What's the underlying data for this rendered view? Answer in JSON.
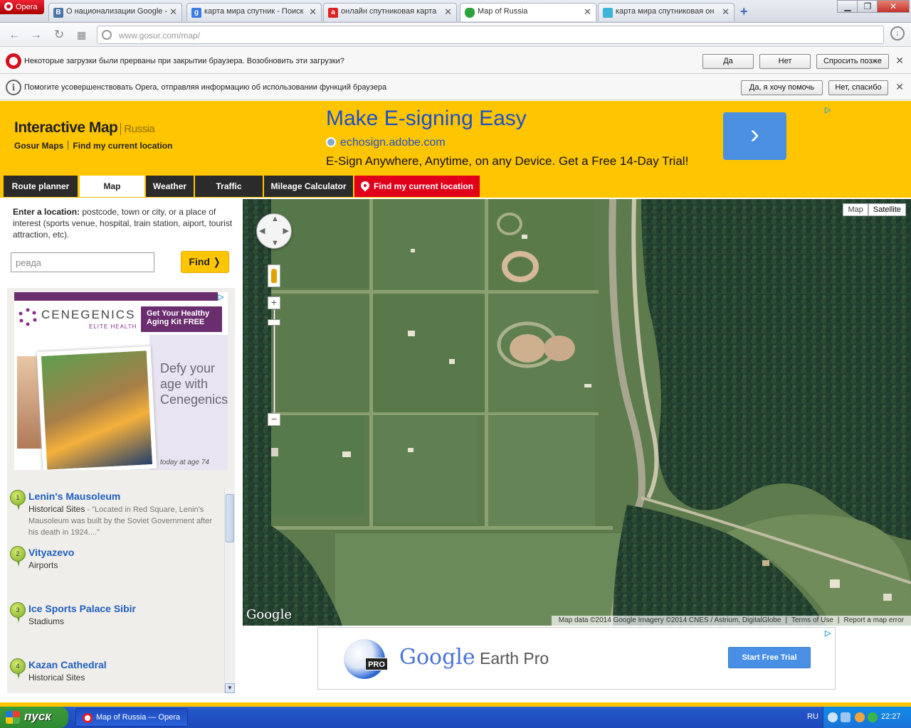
{
  "browser": {
    "menu_label": "Opera",
    "tabs": [
      {
        "label": "О национализации Google -",
        "icon": "vk-icon",
        "fav_letter": "B",
        "fav_color": "#4a76a8"
      },
      {
        "label": "карта мира спутник - Поиск",
        "icon": "google-icon",
        "fav_letter": "g",
        "fav_color": "#3b7be3"
      },
      {
        "label": "онлайн спутниковая карта",
        "icon": "ask-icon",
        "fav_letter": "a",
        "fav_color": "#d22"
      },
      {
        "label": "Map of Russia",
        "icon": "shield-icon",
        "fav_letter": "",
        "fav_color": "#2aa33a"
      },
      {
        "label": "карта мира спутниковая он",
        "icon": "earth-icon",
        "fav_letter": "",
        "fav_color": "#3cb4d8"
      }
    ],
    "url_host": "www.gosur.com",
    "url_path": "/map/",
    "infobar1": {
      "text": "Некоторые загрузки были прерваны при закрытии браузера. Возобновить эти загрузки?",
      "yes": "Да",
      "no": "Нет",
      "later": "Спросить позже"
    },
    "infobar2": {
      "text": "Помогите усовершенствовать Opera, отправляя информацию об использовании функций браузера",
      "yes": "Да, я хочу помочь",
      "no": "Нет, спасибо"
    }
  },
  "site": {
    "title": "Interactive Map",
    "subtitle": "Russia",
    "link1": "Gosur Maps",
    "link2": "Find my current location",
    "nav": [
      "Route planner",
      "Map",
      "Weather",
      "Traffic",
      "Mileage Calculator",
      "Find my current location"
    ],
    "top_ad": {
      "headline": "Make E-signing Easy",
      "url": "echosign.adobe.com",
      "desc": "E-Sign Anywhere, Anytime, on any Device. Get a Free 14-Day Trial!",
      "arrow": "›"
    },
    "location_label_bold": "Enter a location:",
    "location_label_rest": " postcode, town or city, or a place of interest (sports venue, hospital, train station, aiport, tourist attraction, etc).",
    "search_value": "ревда",
    "find_label": "Find  ❭",
    "side_ad": {
      "brand": "CENEGENICS",
      "brand_sub": "ELITE HEALTH",
      "cta": "Get Your Healthy Aging Kit FREE",
      "headline": "Defy your age with Cenegenics",
      "caption": "today at age 74"
    },
    "results": [
      {
        "n": "1",
        "name": "Lenin's Mausoleum",
        "category": "Historical Sites",
        "desc": " - \"Located in Red Square, Lenin's Mausoleum was built by the Soviet Government after his death in 1924....\""
      },
      {
        "n": "2",
        "name": "Vityazevo",
        "category": "Airports",
        "desc": ""
      },
      {
        "n": "3",
        "name": "Ice Sports Palace Sibir",
        "category": "Stadiums",
        "desc": ""
      },
      {
        "n": "4",
        "name": "Kazan Cathedral",
        "category": "Historical Sites",
        "desc": ""
      }
    ]
  },
  "map": {
    "type_map": "Map",
    "type_satellite": "Satellite",
    "logo": "Google",
    "attrib_data": "Map data ©2014 Google Imagery ©2014 CNES / Astrium, DigitalGlobe",
    "attrib_terms": "Terms of Use",
    "attrib_report": "Report a map error",
    "zoom_in": "+",
    "zoom_out": "−"
  },
  "bottom_ad": {
    "title": "Google",
    "title_rest": " Earth Pro",
    "pro_badge": "PRO",
    "cta": "Start Free Trial"
  },
  "taskbar": {
    "start": "пуск",
    "item": "Map of Russia — Opera",
    "lang": "RU",
    "time": "22:27"
  },
  "colors": {
    "brand_yellow": "#ffc600",
    "nav_dark": "#2b2b2b",
    "nav_red": "#e0001a",
    "link_blue": "#1f5fc0"
  }
}
